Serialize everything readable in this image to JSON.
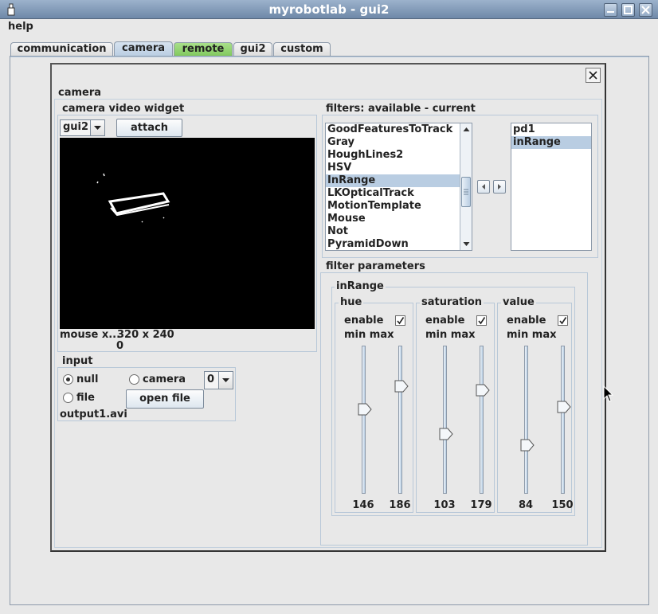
{
  "window": {
    "title": "myrobotlab - gui2",
    "close_glyph": "×"
  },
  "menu": {
    "help": "help"
  },
  "tabs": [
    {
      "label": "communication"
    },
    {
      "label": "camera"
    },
    {
      "label": "remote"
    },
    {
      "label": "gui2"
    },
    {
      "label": "custom"
    }
  ],
  "selected_tab": "camera",
  "panel": {
    "title": "camera",
    "video_widget": {
      "title": "camera  video widget",
      "source_combo": "gui2",
      "attach_button": "attach",
      "mouse_label": "mouse x...",
      "mouse_value": "0",
      "resolution": "320 x 240"
    },
    "input": {
      "title": "input",
      "radio_null": "null",
      "radio_camera": "camera",
      "radio_file": "file",
      "camera_index": "0",
      "open_file_button": "open file",
      "file_name": "output1.avi",
      "selected": "null"
    },
    "filters": {
      "title": "filters: available - current",
      "available": [
        "GoodFeaturesToTrack",
        "Gray",
        "HoughLines2",
        "HSV",
        "InRange",
        "LKOpticalTrack",
        "MotionTemplate",
        "Mouse",
        "Not",
        "PyramidDown"
      ],
      "available_selected": "InRange",
      "current": [
        "pd1",
        "inRange"
      ],
      "current_selected": "inRange"
    },
    "filter_parameters": {
      "title": "filter parameters",
      "filter_name": "inRange",
      "enable_label": "enable",
      "minmax_label": "min max",
      "slider_range": [
        0,
        256
      ],
      "channels": [
        {
          "name": "hue",
          "enabled": true,
          "min": 146,
          "max": 186,
          "min_label": "146",
          "max_label": "186"
        },
        {
          "name": "saturation",
          "enabled": true,
          "min": 103,
          "max": 179,
          "min_label": "103",
          "max_label": "179"
        },
        {
          "name": "value",
          "enabled": true,
          "min": 84,
          "max": 150,
          "min_label": "84",
          "max_label": "150"
        }
      ]
    }
  },
  "colors": {
    "titlebar": "#7f97b4",
    "selection": "#b9cde2",
    "remote_tab": "#8fd06c",
    "video_bg": "#000000"
  }
}
